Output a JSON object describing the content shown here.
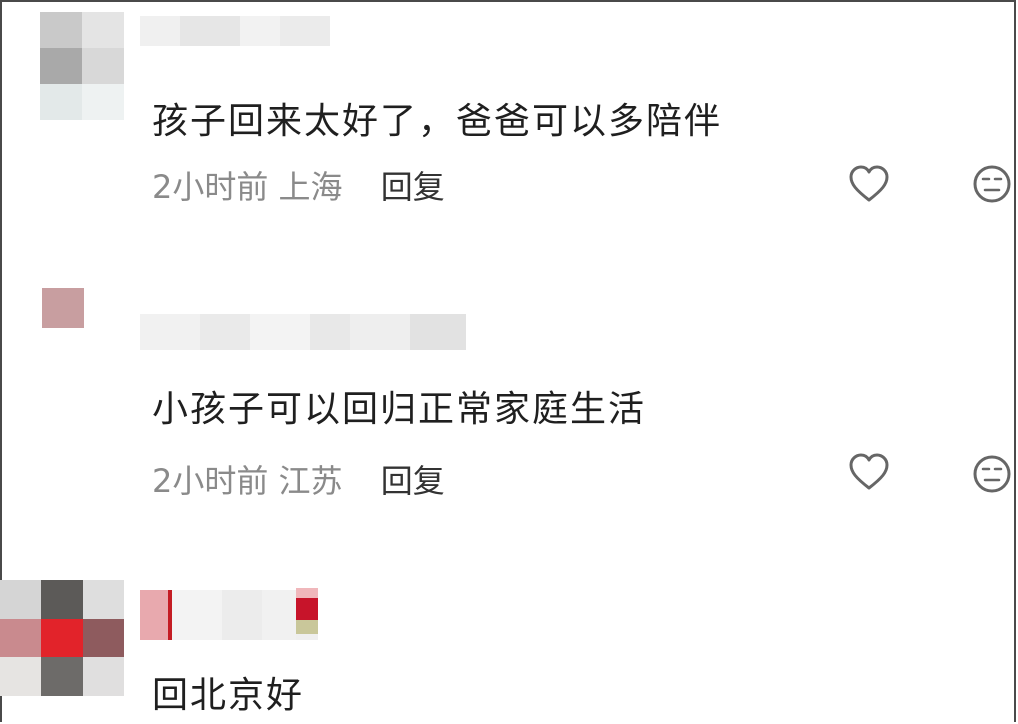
{
  "comments": [
    {
      "text": "孩子回来太好了，爸爸可以多陪伴",
      "time": "2小时前",
      "location": "上海",
      "reply_label": "回复",
      "like_icon": "heart-outline-icon",
      "dislike_icon": "neutral-face-icon"
    },
    {
      "text": "小孩子可以回归正常家庭生活",
      "time": "2小时前",
      "location": "江苏",
      "reply_label": "回复",
      "like_icon": "heart-outline-icon",
      "dislike_icon": "neutral-face-icon"
    },
    {
      "text": "回北京好"
    }
  ],
  "colors": {
    "text": "#1f1f1f",
    "meta": "#8a8a8a",
    "reply": "#333333",
    "icon": "#666666",
    "background": "#ffffff"
  }
}
